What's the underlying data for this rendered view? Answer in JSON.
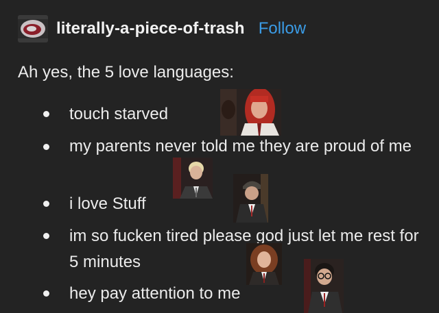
{
  "post": {
    "username": "literally-a-piece-of-trash",
    "follow_label": "Follow",
    "intro": "Ah yes, the 5 love languages:",
    "bullets": [
      "touch starved",
      "my parents never told me they are proud of me",
      "i love Stuff",
      "im so fucken tired please god just let me rest for 5 minutes",
      "hey pay attention to me"
    ]
  },
  "colors": {
    "background": "#232323",
    "text": "#ececec",
    "follow": "#3b9ce6"
  }
}
